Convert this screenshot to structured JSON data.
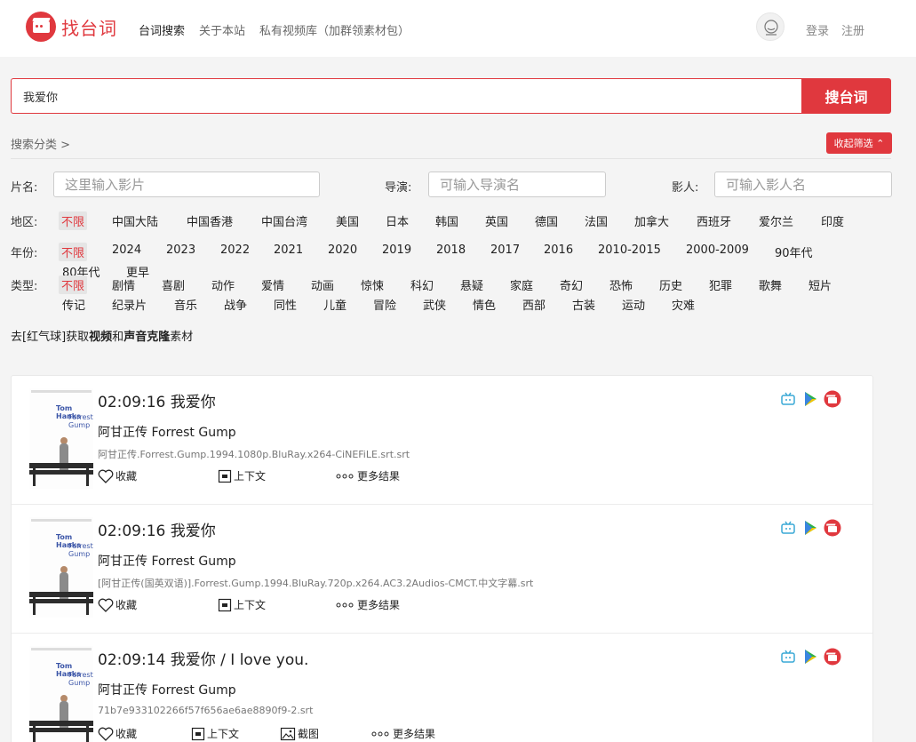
{
  "header": {
    "logo_text": "找台词",
    "nav": [
      "台词搜索",
      "关于本站",
      "私有视频库（加群领素材包）"
    ],
    "login": "登录",
    "register": "注册"
  },
  "search": {
    "value": "我爱你",
    "button": "搜台词"
  },
  "filters": {
    "heading": "搜索分类 >",
    "collapse": "收起筛选 ⌃",
    "title_label": "片名:",
    "title_placeholder": "这里输入影片",
    "director_label": "导演:",
    "director_placeholder": "可输入导演名",
    "actor_label": "影人:",
    "actor_placeholder": "可输入影人名",
    "region_label": "地区:",
    "regions": [
      "不限",
      "中国大陆",
      "中国香港",
      "中国台湾",
      "美国",
      "日本",
      "韩国",
      "英国",
      "德国",
      "法国",
      "加拿大",
      "西班牙",
      "爱尔兰",
      "印度"
    ],
    "year_label": "年份:",
    "years": [
      "不限",
      "2024",
      "2023",
      "2022",
      "2021",
      "2020",
      "2019",
      "2018",
      "2017",
      "2016",
      "2010-2015",
      "2000-2009",
      "90年代",
      "80年代",
      "更早"
    ],
    "genre_label": "类型:",
    "genres_row1": [
      "不限",
      "剧情",
      "喜剧",
      "动作",
      "爱情",
      "动画",
      "惊悚",
      "科幻",
      "悬疑",
      "家庭",
      "奇幻",
      "恐怖",
      "历史",
      "犯罪",
      "歌舞",
      "短片"
    ],
    "genres_row2": [
      "传记",
      "纪录片",
      "音乐",
      "战争",
      "同性",
      "儿童",
      "冒险",
      "武侠",
      "情色",
      "西部",
      "古装",
      "运动",
      "灾难"
    ]
  },
  "promo": {
    "prefix": "去[红气球]获取",
    "video": "视频",
    "and": "和",
    "voice": "声音克隆",
    "suffix": "素材"
  },
  "results": [
    {
      "time_quote": "02:09:16 我爱你",
      "movie": "阿甘正传 Forrest Gump",
      "file": "阿甘正传.Forrest.Gump.1994.1080p.BluRay.x264-CiNEFiLE.srt.srt",
      "actions": [
        "收藏",
        "上下文",
        "更多结果"
      ]
    },
    {
      "time_quote": "02:09:16 我爱你",
      "movie": "阿甘正传 Forrest Gump",
      "file": "[阿甘正传(国英双语)].Forrest.Gump.1994.BluRay.720p.x264.AC3.2Audios-CMCT.中文字幕.srt",
      "actions": [
        "收藏",
        "上下文",
        "更多结果"
      ]
    },
    {
      "time_quote": "02:09:14 我爱你 / I love you.",
      "movie": "阿甘正传 Forrest Gump",
      "file": "71b7e933102266f57f656ae6ae8890f9-2.srt",
      "actions": [
        "收藏",
        "上下文",
        "截图",
        "更多结果"
      ]
    }
  ],
  "poster": {
    "line1": "Tom Hanks",
    "line2": "Forrest",
    "line3": "Gump"
  },
  "colors": {
    "accent": "#e0383e",
    "bilibili": "#3aa9d6",
    "play_green": "#2bb24c",
    "play_yellow": "#f5c400"
  },
  "icons": [
    "bilibili-icon",
    "play-store-icon",
    "video-app-icon",
    "heart-icon",
    "context-icon",
    "screenshot-icon",
    "more-dots-icon",
    "avatar-icon"
  ]
}
